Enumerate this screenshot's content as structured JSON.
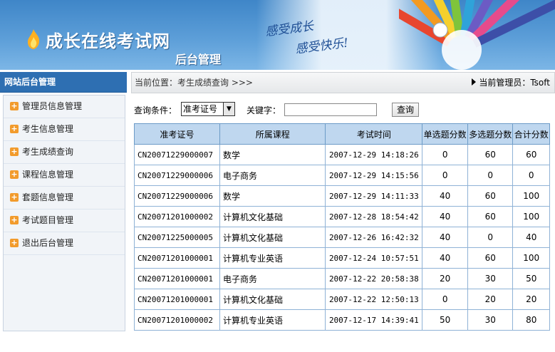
{
  "header": {
    "site_title": "成长在线考试网",
    "admin_title": "后台管理",
    "slogan_line1": "感受成长",
    "slogan_line2": "感受快乐!"
  },
  "sidebar": {
    "title": "网站后台管理",
    "items": [
      {
        "label": "管理员信息管理"
      },
      {
        "label": "考生信息管理"
      },
      {
        "label": "考生成绩查询"
      },
      {
        "label": "课程信息管理"
      },
      {
        "label": "套题信息管理"
      },
      {
        "label": "考试题目管理"
      },
      {
        "label": "退出后台管理"
      }
    ]
  },
  "location": {
    "text": "当前位置：考生成绩查询 >>>",
    "admin_label": "当前管理员：Tsoft"
  },
  "search": {
    "condition_label": "查询条件：",
    "condition_value": "准考证号",
    "keyword_label": "关键字：",
    "keyword_value": "",
    "query_button": "查询"
  },
  "table": {
    "headers": [
      "准考证号",
      "所属课程",
      "考试时间",
      "单选题分数",
      "多选题分数",
      "合计分数"
    ],
    "rows": [
      [
        "CN20071229000007",
        "数学",
        "2007-12-29 14:18:26",
        "0",
        "60",
        "60"
      ],
      [
        "CN20071229000006",
        "电子商务",
        "2007-12-29 14:15:56",
        "0",
        "0",
        "0"
      ],
      [
        "CN20071229000006",
        "数学",
        "2007-12-29 14:11:33",
        "40",
        "60",
        "100"
      ],
      [
        "CN20071201000002",
        "计算机文化基础",
        "2007-12-28 18:54:42",
        "40",
        "60",
        "100"
      ],
      [
        "CN20071225000005",
        "计算机文化基础",
        "2007-12-26 16:42:32",
        "40",
        "0",
        "40"
      ],
      [
        "CN20071201000001",
        "计算机专业英语",
        "2007-12-24 10:57:51",
        "40",
        "60",
        "100"
      ],
      [
        "CN20071201000001",
        "电子商务",
        "2007-12-22 20:58:38",
        "20",
        "30",
        "50"
      ],
      [
        "CN20071201000001",
        "计算机文化基础",
        "2007-12-22 12:50:13",
        "0",
        "20",
        "20"
      ],
      [
        "CN20071201000002",
        "计算机专业英语",
        "2007-12-17 14:39:41",
        "50",
        "30",
        "80"
      ]
    ]
  },
  "colors": {
    "header_blue": "#4a90d0",
    "sidebar_title_bg": "#2e6fb2",
    "table_header_bg": "#bfd7ef",
    "nav_icon_orange": "#f29b2c"
  }
}
